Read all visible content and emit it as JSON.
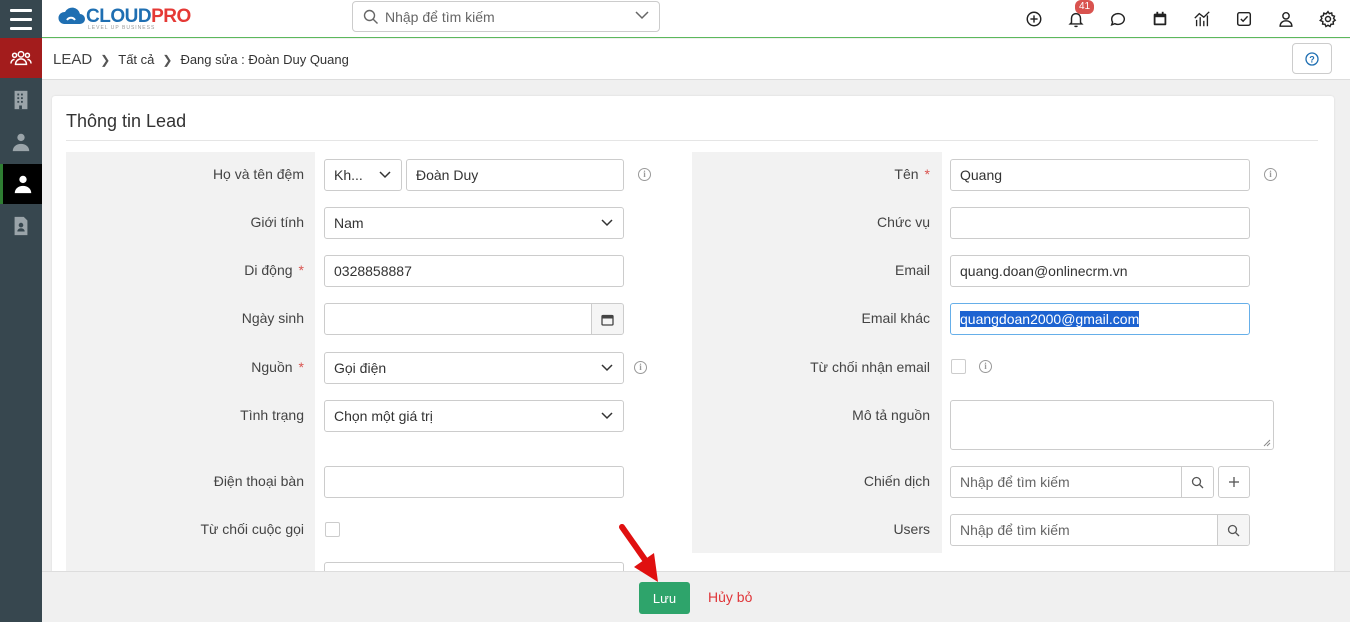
{
  "header": {
    "logo_main": "CLOUD",
    "logo_accent": "PRO",
    "logo_tagline": "LEVEL UP BUSINESS",
    "search_placeholder": "Nhập để tìm kiếm",
    "notification_count": "41"
  },
  "breadcrumb": {
    "module": "LEAD",
    "filter": "Tất cả",
    "current": "Đang sửa : Đoàn Duy Quang"
  },
  "card": {
    "title": "Thông tin Lead"
  },
  "form_left": {
    "fullname_label": "Họ và tên đệm",
    "salutation_value": "Kh...",
    "middle_name_value": "Đoàn Duy",
    "gender_label": "Giới tính",
    "gender_value": "Nam",
    "mobile_label": "Di động",
    "mobile_value": "0328858887",
    "birthday_label": "Ngày sinh",
    "birthday_value": "",
    "source_label": "Nguồn",
    "source_value": "Gọi điện",
    "status_label": "Tình trạng",
    "status_value": "Chọn một giá trị",
    "phone_label": "Điện thoại bàn",
    "phone_value": "",
    "reject_call_label": "Từ chối cuộc gọi"
  },
  "form_right": {
    "lastname_label": "Tên",
    "lastname_value": "Quang",
    "title_label": "Chức vụ",
    "title_value": "",
    "email_label": "Email",
    "email_value": "quang.doan@onlinecrm.vn",
    "other_email_label": "Email khác",
    "other_email_value": "quangdoan2000@gmail.com",
    "reject_email_label": "Từ chối nhận email",
    "source_desc_label": "Mô tả nguồn",
    "source_desc_value": "",
    "campaign_label": "Chiến dịch",
    "campaign_placeholder": "Nhập để tìm kiếm",
    "users_label": "Users",
    "users_placeholder": "Nhập để tìm kiếm"
  },
  "footer": {
    "save_label": "Lưu",
    "cancel_label": "Hủy bỏ"
  },
  "colors": {
    "sidebar_bg": "#37474f",
    "sidebar_active_red": "#a31c1c",
    "save_green": "#2ea46b",
    "cancel_red": "#e0363a",
    "required_red": "#d9534f"
  }
}
